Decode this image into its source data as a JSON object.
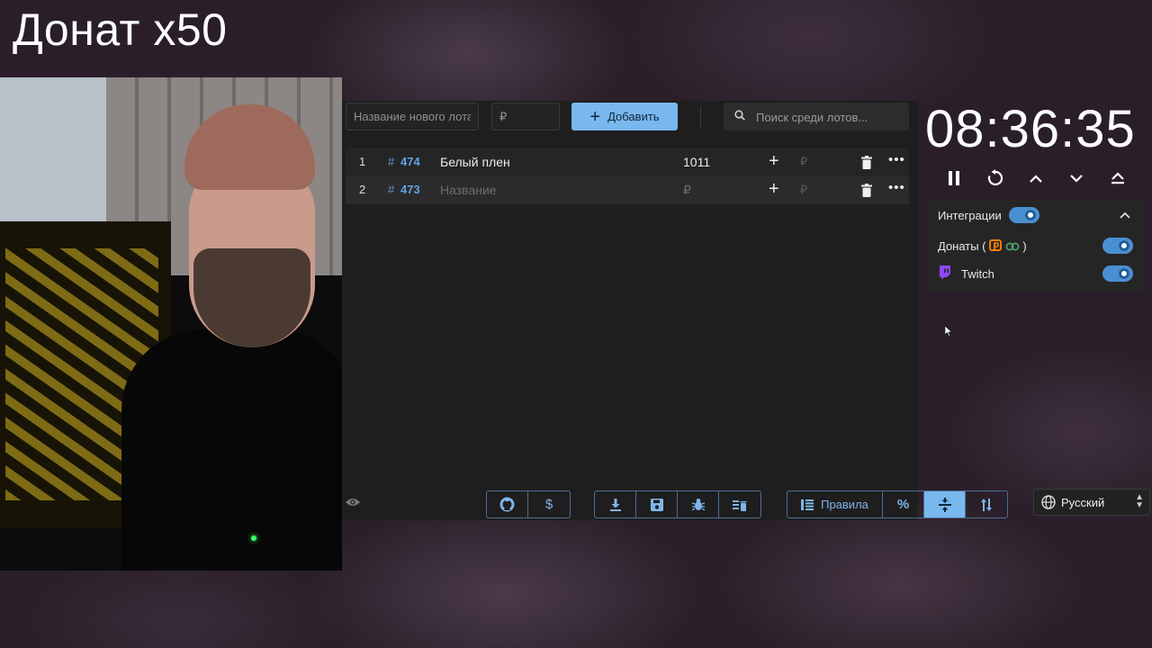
{
  "overlay": {
    "title": "Донат x50"
  },
  "toolbar": {
    "name_placeholder": "Название нового лота",
    "amount_placeholder": "₽",
    "add_label": "Добавить",
    "search_placeholder": "Поиск среди лотов..."
  },
  "lots": [
    {
      "index": "1",
      "hash": "#",
      "id": "474",
      "name": "Белый плен",
      "amount": "1011",
      "currency": "₽"
    },
    {
      "index": "2",
      "hash": "#",
      "id": "473",
      "name": "Название",
      "amount": "₽",
      "currency": "₽"
    }
  ],
  "bottom": {
    "rules_label": "Правила"
  },
  "timer": {
    "value": "08:36:35"
  },
  "integrations": {
    "header": "Интеграции",
    "donations_label": "Донаты (",
    "donations_suffix": ")",
    "twitch_label": "Twitch"
  },
  "language": {
    "selected": "Русский"
  },
  "colors": {
    "accent": "#79b8ee",
    "link": "#5fa3e6",
    "toggle": "#4a8fd2",
    "twitch": "#9146ff",
    "donationalerts": "#f57d07"
  },
  "icons": [
    "github-icon",
    "dollar-icon",
    "download-icon",
    "save-icon",
    "bug-icon",
    "clear-list-icon",
    "rules-icon",
    "percent-icon",
    "compress-icon",
    "sort-icon",
    "pause-icon",
    "restart-icon",
    "chevron-up-icon",
    "chevron-down-icon",
    "eject-icon",
    "globe-icon",
    "eye-icon",
    "trash-icon",
    "more-icon",
    "search-icon"
  ]
}
